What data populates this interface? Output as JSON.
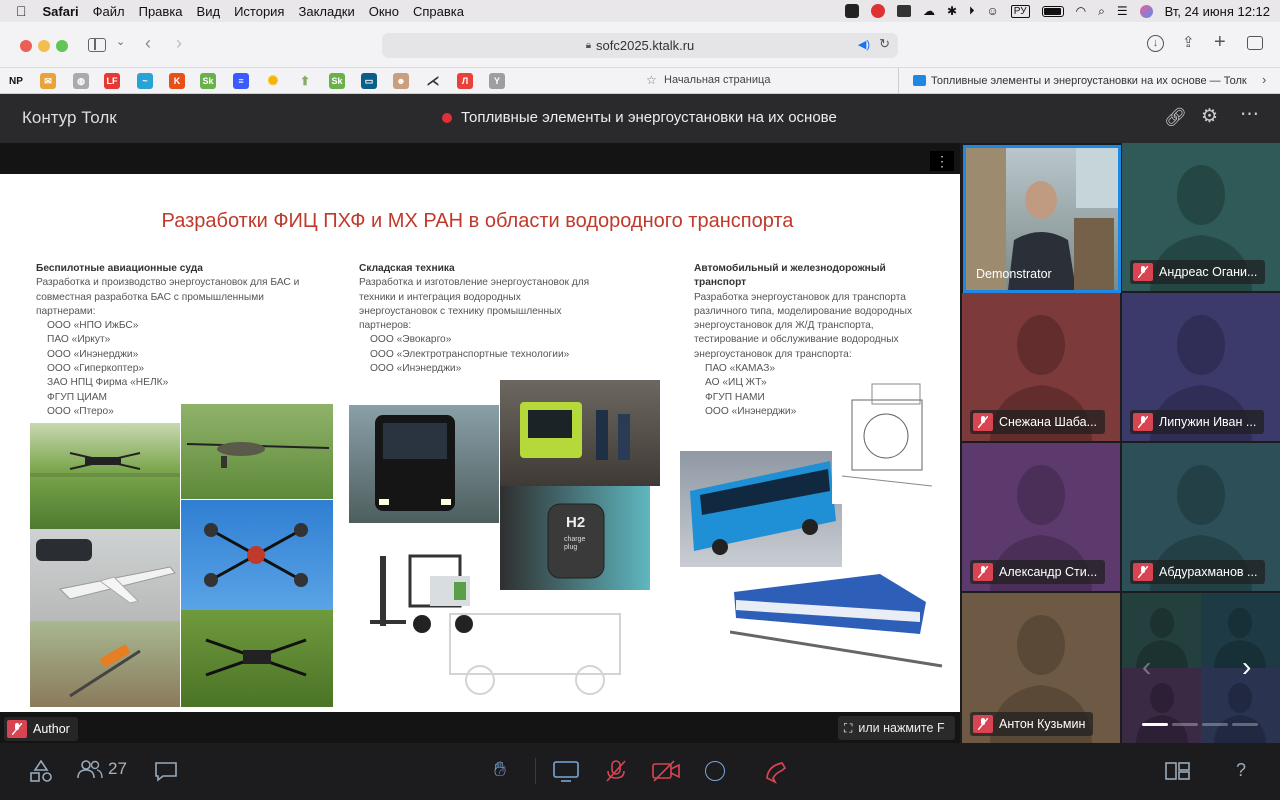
{
  "menubar": {
    "app": "Safari",
    "items": [
      "Файл",
      "Правка",
      "Вид",
      "История",
      "Закладки",
      "Окно",
      "Справка"
    ],
    "lang": "РУ",
    "datetime": "Вт, 24 июня  12:12"
  },
  "browser": {
    "url": "sofc2025.ktalk.ru",
    "bookmark": "Начальная страница",
    "tab_title": "Топливные элементы и энергоустановки на их основе — Толк"
  },
  "app": {
    "logo": "Контур Толк",
    "title": "Топливные элементы и энергоустановки на их основе"
  },
  "slide": {
    "title": "Разработки ФИЦ ПХФ и МХ РАН в области водородного транспорта",
    "col1": {
      "heading": "Беспилотные авиационные суда",
      "text": [
        "Разработка и производство энергоустановок для БАС и",
        "совместная разработка БАС с промышленными",
        "партнерами:"
      ],
      "partners": [
        "ООО «НПО ИжБС»",
        "ПАО «Иркут»",
        "ООО «Инэнерджи»",
        "ООО «Гиперкоптер»",
        "ЗАО НПЦ Фирма «НЕЛК»",
        "ФГУП ЦИАМ",
        "ООО «Птеро»"
      ]
    },
    "col2": {
      "heading": "Складская техника",
      "text": [
        "Разработка и изготовление энергоустановок для",
        "техники и интеграция водородных",
        "энергоустановок с технику промышленных",
        "партнеров:"
      ],
      "partners": [
        "ООО «Эвокарго»",
        "ООО «Электротранспортные технологии»",
        "ООО «Инэнерджи»"
      ]
    },
    "col3": {
      "heading": [
        "Автомобильный  и железнодорожный",
        "транспорт"
      ],
      "text": [
        "Разработка энергоустановок для транспорта",
        "различного типа, моделирование водородных",
        "энергоустановок для Ж/Д транспорта,",
        "тестирование и обслуживание водородных",
        "энергоустановок для транспорта:"
      ],
      "partners": [
        "ПАО «КАМАЗ»",
        "АО «ИЦ ЖТ»",
        "ФГУП НАМИ",
        "ООО «Инэнерджи»"
      ]
    },
    "h2_label": "H2",
    "charge_label": "charge plug"
  },
  "stage": {
    "author": "Author",
    "fullscreen_hint": "или нажмите F"
  },
  "participants": [
    {
      "name": "Demonstrator",
      "muted": false,
      "color": "#3a6ea5"
    },
    {
      "name": "Андреас Огани...",
      "muted": true,
      "color": "#2f5a57"
    },
    {
      "name": "Снежана Шаба...",
      "muted": true,
      "color": "#7c3a3a"
    },
    {
      "name": "Липужин Иван ...",
      "muted": true,
      "color": "#3c3a6a"
    },
    {
      "name": "Александр Сти...",
      "muted": true,
      "color": "#5d3a6d"
    },
    {
      "name": "Абдурахманов ...",
      "muted": true,
      "color": "#2d5058"
    },
    {
      "name": "Антон Кузьмин",
      "muted": true,
      "color": "#6e5a44"
    }
  ],
  "bottom": {
    "participant_count": "27"
  },
  "colors": {
    "accent": "#1e88e5",
    "danger": "#d84452",
    "slide_title": "#c0392b"
  }
}
